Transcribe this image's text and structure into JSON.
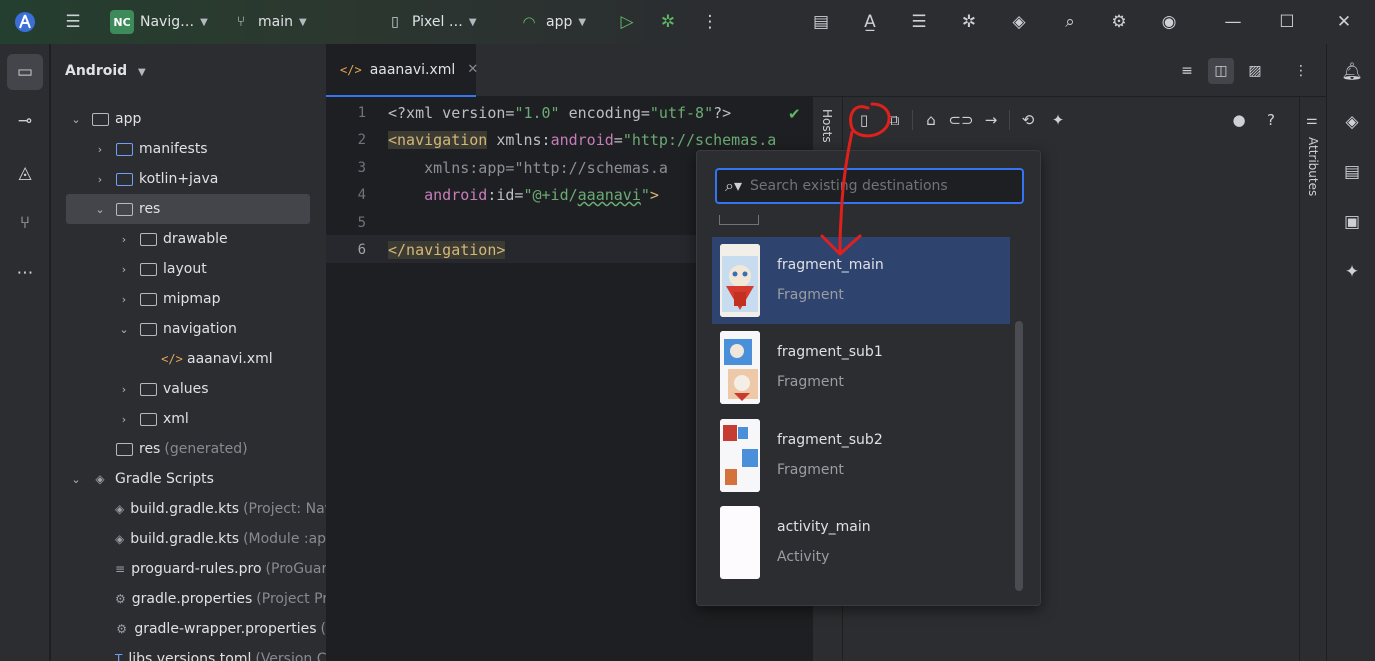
{
  "titlebar": {
    "project_badge": "NC",
    "project_name": "Navig…",
    "branch": "main",
    "device": "Pixel …",
    "run_config": "app"
  },
  "project_panel": {
    "view": "Android",
    "tree": [
      {
        "label": "app",
        "muted": ""
      },
      {
        "label": "manifests",
        "muted": ""
      },
      {
        "label": "kotlin+java",
        "muted": ""
      },
      {
        "label": "res",
        "muted": ""
      },
      {
        "label": "drawable",
        "muted": ""
      },
      {
        "label": "layout",
        "muted": ""
      },
      {
        "label": "mipmap",
        "muted": ""
      },
      {
        "label": "navigation",
        "muted": ""
      },
      {
        "label": "aaanavi.xml",
        "muted": ""
      },
      {
        "label": "values",
        "muted": ""
      },
      {
        "label": "xml",
        "muted": ""
      },
      {
        "label": "res",
        "muted": "(generated)"
      },
      {
        "label": "Gradle Scripts",
        "muted": ""
      },
      {
        "label": "build.gradle.kts",
        "muted": "(Project: Nav"
      },
      {
        "label": "build.gradle.kts",
        "muted": "(Module :ap"
      },
      {
        "label": "proguard-rules.pro",
        "muted": "(ProGuar"
      },
      {
        "label": "gradle.properties",
        "muted": "(Project Pr"
      },
      {
        "label": "gradle-wrapper.properties",
        "muted": "("
      },
      {
        "label": "libs.versions.toml",
        "muted": "(Version C"
      }
    ]
  },
  "editor": {
    "tab_title": "aaanavi.xml",
    "line_numbers": [
      "1",
      "2",
      "3",
      "4",
      "5",
      "6"
    ],
    "code": {
      "l1_a": "<?xml version=",
      "l1_b": "\"1.0\"",
      "l1_c": " encoding=",
      "l1_d": "\"utf-8\"",
      "l1_e": "?>",
      "l2_tag": "<navigation",
      "l2_attr": " xmlns:",
      "l2_ns": "android",
      "l2_eq": "=",
      "l2_val": "\"http://schemas.a",
      "l3_attr": "    xmlns:app=",
      "l3_val": "\"http://schemas.a",
      "l4_ns": "    android",
      "l4_attr": ":id=",
      "l4_val_a": "\"@+id/",
      "l4_val_b": "aaanavi",
      "l4_val_c": "\"",
      "l4_close": ">",
      "l6": "</navigation>"
    }
  },
  "design": {
    "hosts_label": "Hosts",
    "attributes_label": "Attributes"
  },
  "popup": {
    "search_placeholder": "Search existing destinations",
    "destinations": [
      {
        "name": "fragment_main",
        "type": "Fragment"
      },
      {
        "name": "fragment_sub1",
        "type": "Fragment"
      },
      {
        "name": "fragment_sub2",
        "type": "Fragment"
      },
      {
        "name": "activity_main",
        "type": "Activity"
      }
    ]
  },
  "colors": {
    "accent": "#3574f0",
    "selection": "#2e436e",
    "annotation": "#e0201c"
  }
}
